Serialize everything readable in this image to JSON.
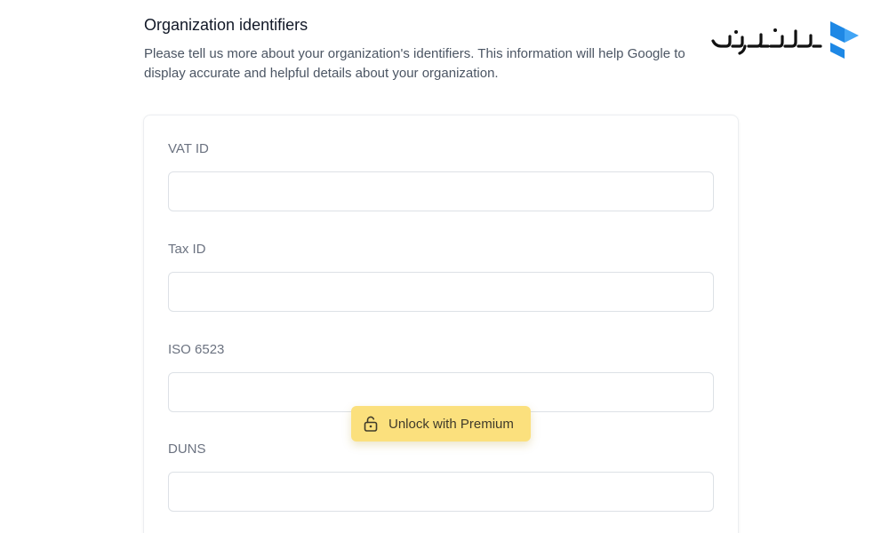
{
  "section": {
    "title": "Organization identifiers",
    "description": "Please tell us more about your organization's identifiers. This information will help Google to display accurate and helpful details about your organization."
  },
  "fields": [
    {
      "label": "VAT ID",
      "value": "",
      "placeholder": ""
    },
    {
      "label": "Tax ID",
      "value": "",
      "placeholder": ""
    },
    {
      "label": "ISO 6523",
      "value": "",
      "placeholder": ""
    },
    {
      "label": "DUNS",
      "value": "",
      "placeholder": ""
    }
  ],
  "premium": {
    "label": "Unlock with Premium",
    "icon": "unlock-icon"
  },
  "colors": {
    "premium_bg": "#fbe07d",
    "watermark_blue": "#1e88e5"
  }
}
